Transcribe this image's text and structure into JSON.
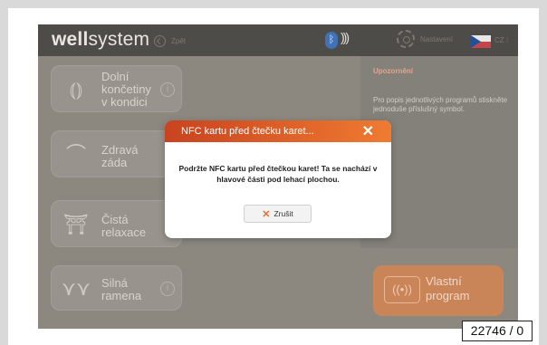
{
  "topbar": {
    "brand_bold": "well",
    "brand_rest": "system",
    "back_label": "Zpět",
    "bluetooth_icon": "bluetooth-icon",
    "nfc_icon": "nfc-waves-icon",
    "settings_label": "Nastavení",
    "language": "CZ"
  },
  "programs": [
    {
      "label_lines": [
        "Dolní",
        "končetiny",
        "v kondici"
      ],
      "icon": "legs-icon"
    },
    {
      "label_lines": [
        "Zdravá",
        "záda"
      ],
      "icon": "back-icon"
    },
    {
      "label_lines": [
        "Čistá",
        "relaxace"
      ],
      "icon": "relax-icon"
    },
    {
      "label_lines": [
        "Silná",
        "ramena"
      ],
      "icon": "shoulders-icon"
    }
  ],
  "right_panel": {
    "title": "Upozornění",
    "text": "Pro popis jednotlivých programů stiskněte jednoduše příslušný symbol."
  },
  "custom_program": {
    "line1": "Vlastní",
    "line2": "program"
  },
  "dialog": {
    "title": "NFC kartu před čtečku karet...",
    "message": "Podržte NFC kartu před čtečkou karet! Ta se nachází v hlavové části pod lehací plochou.",
    "cancel_label": "Zrušit"
  },
  "figure_id": "22746 / 0",
  "colors": {
    "accent": "#ef7b31",
    "header_dark": "#4e4c48",
    "overlay": "#8c8880"
  }
}
